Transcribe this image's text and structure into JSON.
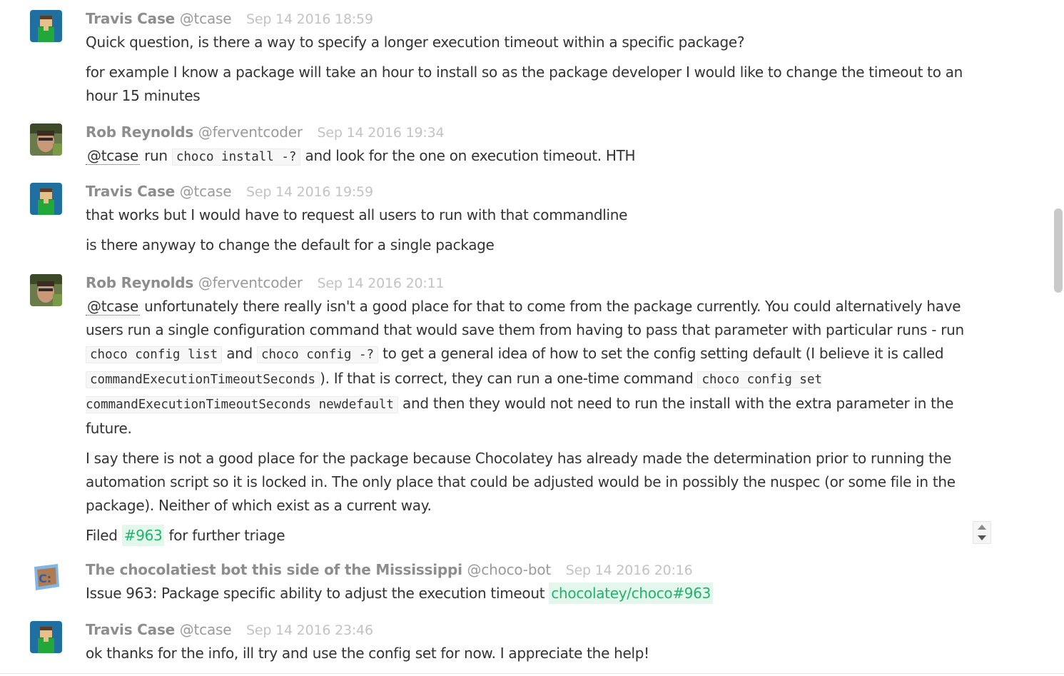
{
  "messages": [
    {
      "author": "Travis Case",
      "handle": "@tcase",
      "time": "Sep 14 2016 18:59",
      "lines": [
        "Quick question, is there a way to specify a longer execution timeout within a specific package?",
        "for example I know a package will take an hour to install so as the package developer I would like to change the timeout to an hour 15 minutes"
      ]
    },
    {
      "author": "Rob Reynolds",
      "handle": "@ferventcoder",
      "time": "Sep 14 2016 19:34",
      "mention": "@tcase",
      "run": "run",
      "code": "choco install -?",
      "tail": "and look for the one on execution timeout. HTH"
    },
    {
      "author": "Travis Case",
      "handle": "@tcase",
      "time": "Sep 14 2016 19:59",
      "lines": [
        "that works but I would have to request all users to run with that commandline",
        "is there anyway to change the default for a single package"
      ]
    },
    {
      "author": "Rob Reynolds",
      "handle": "@ferventcoder",
      "time": "Sep 14 2016 20:11",
      "p1": {
        "mention": "@tcase",
        "t1": "unfortunately there really isn't a good place for that to come from the package currently. You could alternatively have users run a single configuration command that would save them from having to pass that parameter with particular runs - run",
        "c1": "choco config list",
        "t2": "and",
        "c2": "choco config -?",
        "t3": "to get a general idea of how to set the config setting default (I believe it is called",
        "c3": "commandExecutionTimeoutSeconds",
        "t4": "). If that is correct, they can run a one-time command",
        "c4": "choco config set commandExecutionTimeoutSeconds newdefault",
        "t5": "and then they would not need to run the install with the extra parameter in the future."
      },
      "p2": "I say there is not a good place for the package because Chocolatey has already made the determination prior to running the automation script so it is locked in. The only place that could be adjusted would be in possibly the nuspec (or some file in the package). Neither of which exist as a current way.",
      "p3": {
        "t1": "Filed",
        "link": "#963",
        "t2": "for further triage"
      }
    },
    {
      "author": "The chocolatiest bot this side of the Mississippi",
      "handle": "@choco-bot",
      "time": "Sep 14 2016 20:16",
      "text": "Issue 963: Package specific ability to adjust the execution timeout",
      "link": "chocolatey/choco#963"
    },
    {
      "author": "Travis Case",
      "handle": "@tcase",
      "time": "Sep 14 2016 23:46",
      "text": "ok thanks for the info, ill try and use the config set for now. I appreciate the help!"
    }
  ],
  "colors": {
    "link": "#1fb36b",
    "link_bg": "#e3f7ec",
    "author": "#8d8d8d",
    "time": "#c3c3c3"
  }
}
